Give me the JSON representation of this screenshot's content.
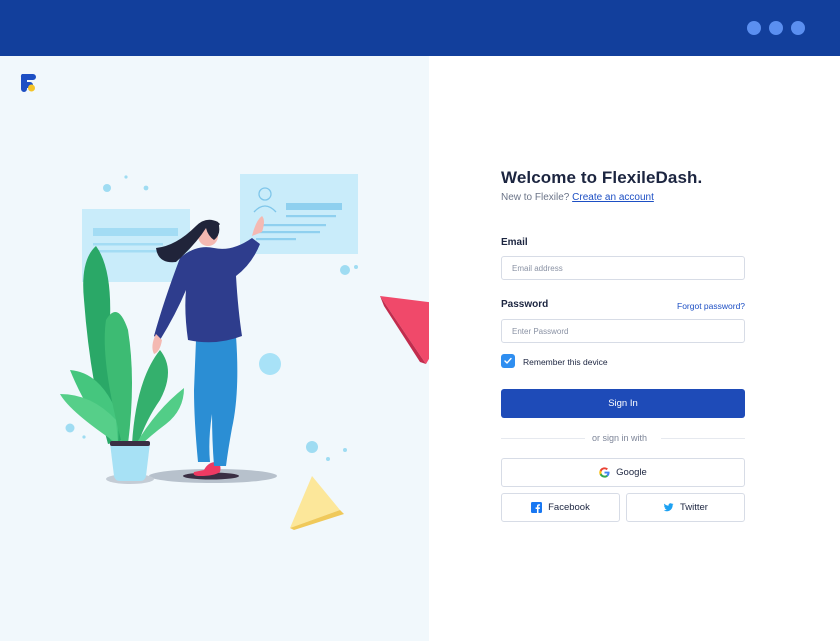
{
  "window": {
    "controls": [
      "dot-1",
      "dot-2",
      "dot-3"
    ]
  },
  "brand": {
    "logo_icon": "flexiledash-logo-icon"
  },
  "login": {
    "title": "Welcome to FlexileDash.",
    "new_prompt": "New to Flexile?",
    "create_account": "Create an account",
    "email_label": "Email",
    "email_placeholder": "Email address",
    "email_value": "",
    "password_label": "Password",
    "password_placeholder": "Enter Password",
    "password_value": "",
    "forgot_password": "Forgot password?",
    "remember_label": "Remember this device",
    "remember_checked": true,
    "signin_label": "Sign In",
    "divider_text": "or sign in with",
    "google_label": "Google",
    "facebook_label": "Facebook",
    "twitter_label": "Twitter"
  },
  "colors": {
    "topbar": "#123f9c",
    "primary": "#1e4bb8",
    "link": "#1d4fc4",
    "checkbox": "#2f8ef0",
    "left_panel_bg": "#f1f8fc"
  }
}
